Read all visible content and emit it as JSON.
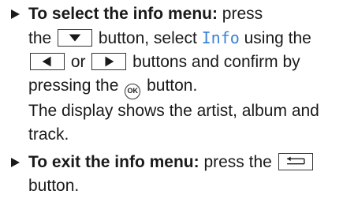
{
  "step1": {
    "lead": "To select the info menu:",
    "t1": " press",
    "t2": "the ",
    "t3": " button, select ",
    "menu_word": "Info",
    "t4": " using the",
    "t5": " or ",
    "t6": " buttons and confirm by",
    "t7": "pressing the ",
    "ok_label": "OK",
    "t8": " button.",
    "line5": "The display shows the artist, album and",
    "line6": "track."
  },
  "step2": {
    "lead": "To exit the info menu:",
    "t1": " press the ",
    "line2": "button."
  },
  "icons": {
    "down": "down-triangle-icon",
    "left": "left-triangle-icon",
    "right": "right-triangle-icon",
    "back": "back-arrow-icon",
    "ok": "ok-icon"
  }
}
